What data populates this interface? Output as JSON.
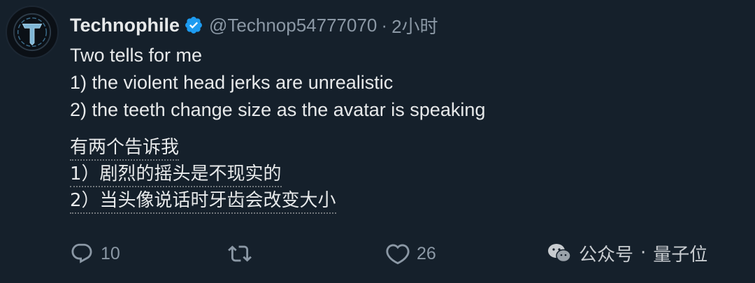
{
  "tweet": {
    "author": {
      "display_name": "Technophile",
      "handle": "@Technop54777070",
      "verified_icon": "verified-badge-icon",
      "avatar_icon": "technophile-t-logo"
    },
    "separator": "·",
    "time": "2小时",
    "body_lines": [
      "Two tells for me",
      "1) the violent head jerks are unrealistic",
      "2) the teeth change size as the avatar is speaking"
    ],
    "translation_lines": [
      "有两个告诉我",
      "1）剧烈的摇头是不现实的",
      "2）当头像说话时牙齿会改变大小"
    ],
    "actions": {
      "reply_count": "10",
      "like_count": "26"
    }
  },
  "watermark": {
    "text": "公众号",
    "separator": "·",
    "name": "量子位"
  },
  "colors": {
    "background": "#15202b",
    "text_primary": "#e7e9ea",
    "text_secondary": "#8b98a5",
    "verified_blue": "#1d9bf0"
  }
}
